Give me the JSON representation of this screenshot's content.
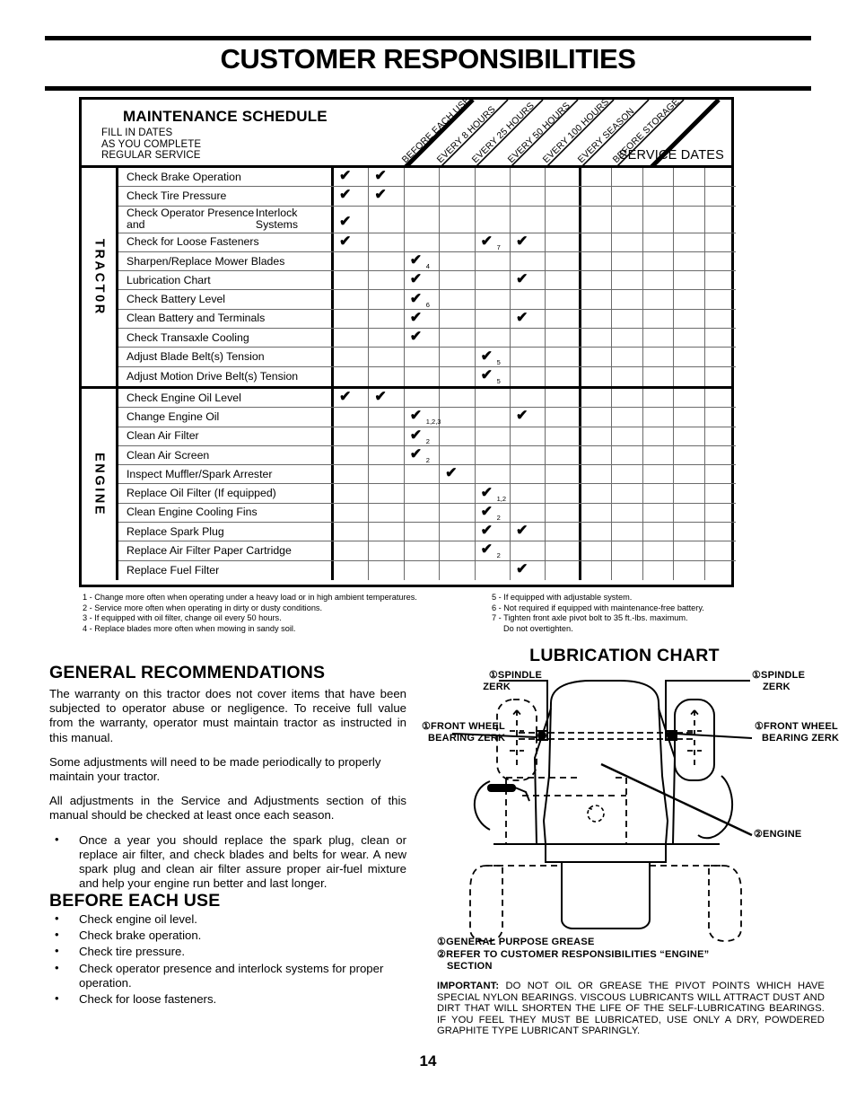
{
  "header": {
    "title": "CUSTOMER RESPONSIBILITIES"
  },
  "page_number": "14",
  "schedule": {
    "title": "MAINTENANCE SCHEDULE",
    "subtitle_lines": [
      "FILL IN DATES",
      "AS YOU COMPLETE",
      "REGULAR SERVICE"
    ],
    "service_dates_label": "SERVICE DATES",
    "columns": [
      "BEFORE EACH USE",
      "EVERY 8 HOURS",
      "EVERY 25 HOURS",
      "EVERY 50 HOURS",
      "EVERY 100 HOURS",
      "EVERY SEASON",
      "BEFORE STORAGE"
    ],
    "service_date_columns": 5,
    "check_glyph": "✔",
    "sections": [
      {
        "label": "TRACT0R",
        "rows": [
          {
            "task": "Check Brake Operation",
            "marks": [
              {
                "col": 0
              },
              {
                "col": 1
              }
            ]
          },
          {
            "task": "Check Tire Pressure",
            "marks": [
              {
                "col": 0
              },
              {
                "col": 1
              }
            ]
          },
          {
            "task": "Check Operator Presence and\nInterlock Systems",
            "marks": [
              {
                "col": 0
              }
            ]
          },
          {
            "task": "Check for Loose Fasteners",
            "marks": [
              {
                "col": 0
              },
              {
                "col": 4,
                "note": "7"
              },
              {
                "col": 5
              }
            ]
          },
          {
            "task": "Sharpen/Replace Mower Blades",
            "marks": [
              {
                "col": 2,
                "note": "4"
              }
            ]
          },
          {
            "task": "Lubrication Chart",
            "marks": [
              {
                "col": 2
              },
              {
                "col": 5
              }
            ]
          },
          {
            "task": "Check Battery Level",
            "marks": [
              {
                "col": 2,
                "note": "6"
              }
            ]
          },
          {
            "task": "Clean Battery and Terminals",
            "marks": [
              {
                "col": 2
              },
              {
                "col": 5
              }
            ]
          },
          {
            "task": "Check Transaxle Cooling",
            "marks": [
              {
                "col": 2
              }
            ]
          },
          {
            "task": "Adjust Blade Belt(s) Tension",
            "marks": [
              {
                "col": 4,
                "note": "5"
              }
            ]
          },
          {
            "task": "Adjust Motion Drive Belt(s) Tension",
            "marks": [
              {
                "col": 4,
                "note": "5"
              }
            ]
          }
        ]
      },
      {
        "label": "ENGINE",
        "rows": [
          {
            "task": "Check Engine Oil Level",
            "marks": [
              {
                "col": 0
              },
              {
                "col": 1
              }
            ]
          },
          {
            "task": "Change Engine Oil",
            "marks": [
              {
                "col": 2,
                "note": "1,2,3"
              },
              {
                "col": 5
              }
            ]
          },
          {
            "task": "Clean Air Filter",
            "marks": [
              {
                "col": 2,
                "note": "2"
              }
            ]
          },
          {
            "task": "Clean Air Screen",
            "marks": [
              {
                "col": 2,
                "note": "2"
              }
            ]
          },
          {
            "task": "Inspect Muffler/Spark Arrester",
            "marks": [
              {
                "col": 3
              }
            ]
          },
          {
            "task": "Replace Oil Filter (If equipped)",
            "marks": [
              {
                "col": 4,
                "note": "1,2"
              }
            ]
          },
          {
            "task": "Clean Engine Cooling Fins",
            "marks": [
              {
                "col": 4,
                "note": "2"
              }
            ]
          },
          {
            "task": "Replace Spark Plug",
            "marks": [
              {
                "col": 4
              },
              {
                "col": 5
              }
            ]
          },
          {
            "task": "Replace Air Filter Paper Cartridge",
            "marks": [
              {
                "col": 4,
                "note": "2"
              }
            ]
          },
          {
            "task": "Replace Fuel Filter",
            "marks": [
              {
                "col": 5
              }
            ]
          }
        ]
      }
    ]
  },
  "footnotes_left": [
    "1 - Change more often when operating under a heavy load or in high ambient temperatures.",
    "2 - Service more often when operating in dirty or dusty conditions.",
    "3 - If equipped with oil filter, change oil every 50 hours.",
    "4 - Replace blades more often when mowing in sandy soil."
  ],
  "footnotes_right": [
    "5 - If equipped with adjustable system.",
    "6 - Not required if equipped with maintenance-free battery.",
    "7 - Tighten front axle pivot bolt to 35 ft.-lbs. maximum."
  ],
  "footnotes_right_cont": "Do not overtighten.",
  "general": {
    "heading": "GENERAL  RECOMMENDATIONS",
    "paragraphs": [
      "The warranty on this tractor does not cover items that have been subjected to operator abuse or negligence.  To receive full value from the warranty, operator must maintain tractor as instructed in this manual.",
      "Some adjustments will need to be made periodically to properly maintain your tractor.",
      "All adjustments in the Service and Adjustments section of this manual should be checked at least once each season."
    ],
    "bullets": [
      "Once a year you should replace the spark plug, clean or replace air filter, and check blades and belts for wear.  A new spark plug and clean air filter assure proper air-fuel mixture and help your engine run better and last longer."
    ]
  },
  "before_each_use": {
    "heading": "BEFORE EACH USE",
    "bullets": [
      "Check engine oil level.",
      "Check brake operation.",
      "Check tire pressure.",
      "Check operator presence and interlock systems for proper operation.",
      "Check for loose fasteners."
    ]
  },
  "lubrication": {
    "title": "LUBRICATION  CHART",
    "callouts": {
      "spindle_left": "①SPINDLE\nZERK",
      "spindle_left_l1": "①SPINDLE",
      "spindle_left_l2": "ZERK",
      "spindle_right_l1": "①SPINDLE",
      "spindle_right_l2": "ZERK",
      "front_wheel_left_l1": "①FRONT  WHEEL",
      "front_wheel_left_l2": "BEARING  ZERK",
      "front_wheel_right_l1": "①FRONT  WHEEL",
      "front_wheel_right_l2": "BEARING  ZERK",
      "engine": "②ENGINE"
    },
    "notes": [
      "①GENERAL  PURPOSE  GREASE",
      "②REFER  TO  CUSTOMER  RESPONSIBILITIES  “ENGINE”"
    ],
    "notes_cont": "SECTION",
    "important_label": "IMPORTANT:",
    "important_text": "  DO NOT OIL OR GREASE THE PIVOT POINTS WHICH HAVE SPECIAL NYLON BEARINGS.  VISCOUS LUBRICANTS WILL ATTRACT DUST AND DIRT THAT WILL SHORTEN THE LIFE OF THE SELF-LUBRICATING BEARINGS.  IF YOU FEEL THEY MUST BE LUBRICATED, USE ONLY A DRY, POWDERED GRAPHITE TYPE LUBRICANT SPARINGLY."
  }
}
